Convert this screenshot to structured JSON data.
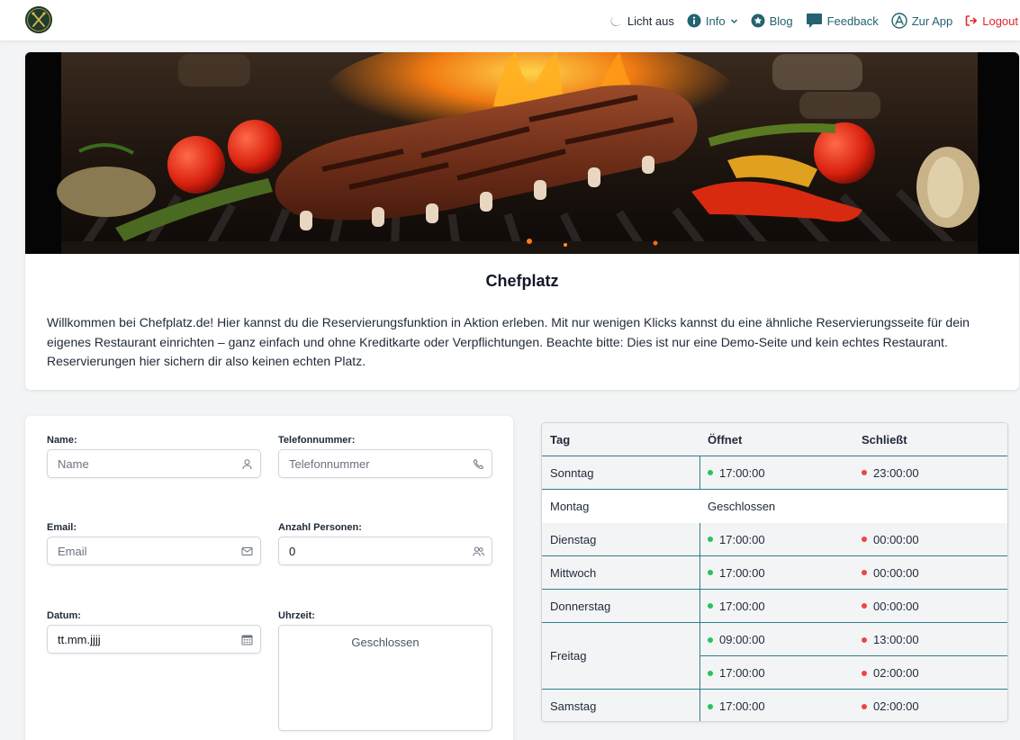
{
  "nav": {
    "items": [
      {
        "key": "theme",
        "label": "Licht aus",
        "icon": "moon-icon",
        "color": "#1f2937"
      },
      {
        "key": "info",
        "label": "Info",
        "icon": "info-icon",
        "color": "#24636f",
        "dropdown": true
      },
      {
        "key": "blog",
        "label": "Blog",
        "icon": "star-badge-icon",
        "color": "#24636f"
      },
      {
        "key": "feedback",
        "label": "Feedback",
        "icon": "chat-bubble-icon",
        "color": "#24636f"
      },
      {
        "key": "app",
        "label": "Zur App",
        "icon": "app-store-icon",
        "color": "#24636f"
      },
      {
        "key": "logout",
        "label": "Logout",
        "icon": "logout-icon",
        "color": "#e0252f"
      }
    ]
  },
  "hero": {
    "title": "Chefplatz",
    "text": "Willkommen bei Chefplatz.de! Hier kannst du die Reservierungsfunktion in Aktion erleben. Mit nur wenigen Klicks kannst du eine ähnliche Reservierungsseite für dein eigenes Restaurant einrichten – ganz einfach und ohne Kreditkarte oder Verpflichtungen. Beachte bitte: Dies ist nur eine Demo-Seite und kein echtes Restaurant. Reservierungen hier sichern dir also keinen echten Platz."
  },
  "form": {
    "name": {
      "label": "Name:",
      "placeholder": "Name",
      "icon": "user-icon"
    },
    "phone": {
      "label": "Telefonnummer:",
      "placeholder": "Telefonnummer",
      "icon": "phone-icon"
    },
    "email": {
      "label": "Email:",
      "placeholder": "Email",
      "icon": "envelope-icon"
    },
    "persons": {
      "label": "Anzahl Personen:",
      "value": "0",
      "icon": "users-icon"
    },
    "date": {
      "label": "Datum:",
      "value": "tt.mm.jjjj",
      "icon": "calendar-icon"
    },
    "time": {
      "label": "Uhrzeit:",
      "status": "Geschlossen"
    }
  },
  "hours": {
    "headers": {
      "day": "Tag",
      "opens": "Öffnet",
      "closes": "Schließt"
    },
    "rows": [
      {
        "day": "Sonntag",
        "slots": [
          {
            "open": "17:00:00",
            "close": "23:00:00"
          }
        ]
      },
      {
        "day": "Montag",
        "closed": "Geschlossen"
      },
      {
        "day": "Dienstag",
        "slots": [
          {
            "open": "17:00:00",
            "close": "00:00:00"
          }
        ]
      },
      {
        "day": "Mittwoch",
        "slots": [
          {
            "open": "17:00:00",
            "close": "00:00:00"
          }
        ]
      },
      {
        "day": "Donnerstag",
        "slots": [
          {
            "open": "17:00:00",
            "close": "00:00:00"
          }
        ]
      },
      {
        "day": "Freitag",
        "slots": [
          {
            "open": "09:00:00",
            "close": "13:00:00"
          },
          {
            "open": "17:00:00",
            "close": "02:00:00"
          }
        ]
      },
      {
        "day": "Samstag",
        "slots": [
          {
            "open": "17:00:00",
            "close": "02:00:00"
          }
        ]
      }
    ]
  },
  "colors": {
    "accent": "#24636f",
    "logout": "#e0252f",
    "open_dot": "#22c55e",
    "close_dot": "#ef4444"
  }
}
